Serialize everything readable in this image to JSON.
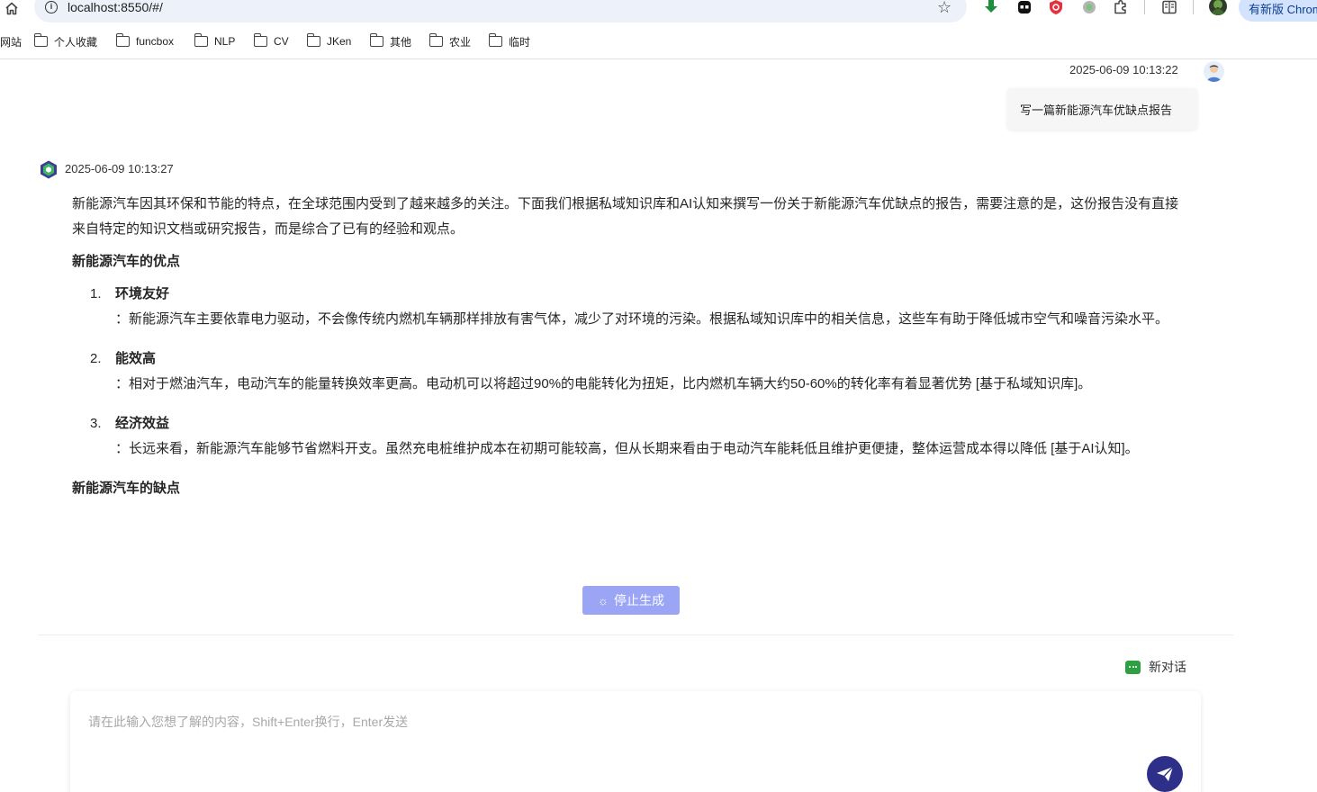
{
  "browser": {
    "url": "localhost:8550/#/",
    "update_label": "有新版 Chrome",
    "bookmarks": [
      {
        "label": "网站",
        "folder": false
      },
      {
        "label": "个人收藏",
        "folder": true
      },
      {
        "label": "funcbox",
        "folder": true
      },
      {
        "label": "NLP",
        "folder": true
      },
      {
        "label": "CV",
        "folder": true
      },
      {
        "label": "JKen",
        "folder": true
      },
      {
        "label": "其他",
        "folder": true
      },
      {
        "label": "农业",
        "folder": true
      },
      {
        "label": "临时",
        "folder": true
      }
    ]
  },
  "chat": {
    "user_message": {
      "time": "2025-06-09 10:13:22",
      "text": "写一篇新能源汽车优缺点报告"
    },
    "bot_message": {
      "time": "2025-06-09 10:13:27",
      "intro": "新能源汽车因其环保和节能的特点，在全球范围内受到了越来越多的关注。下面我们根据私域知识库和AI认知来撰写一份关于新能源汽车优缺点的报告，需要注意的是，这份报告没有直接来自特定的知识文档或研究报告，而是综合了已有的经验和观点。",
      "advantages_title": "新能源汽车的优点",
      "advantages": [
        {
          "num": "1.",
          "title": "环境友好",
          "desc": "：新能源汽车主要依靠电力驱动，不会像传统内燃机车辆那样排放有害气体，减少了对环境的污染。根据私域知识库中的相关信息，这些车有助于降低城市空气和噪音污染水平。"
        },
        {
          "num": "2.",
          "title": "能效高",
          "desc": "：相对于燃油汽车，电动汽车的能量转换效率更高。电动机可以将超过90%的电能转化为扭矩，比内燃机车辆大约50-60%的转化率有着显著优势 [基于私域知识库]。"
        },
        {
          "num": "3.",
          "title": "经济效益",
          "desc": "：长远来看，新能源汽车能够节省燃料开支。虽然充电桩维护成本在初期可能较高，但从长期来看由于电动汽车能耗低且维护更便捷，整体运营成本得以降低 [基于AI认知]。"
        }
      ],
      "disadvantages_title": "新能源汽车的缺点"
    },
    "stop_label": "停止生成",
    "new_chat_label": "新对话",
    "input": {
      "value": "",
      "placeholder": "请在此输入您想了解的内容，Shift+Enter换行，Enter发送"
    }
  },
  "icons": {
    "home": "home-icon",
    "info": "site-info-icon",
    "star": "bookmark-star-icon",
    "download": "download-icon",
    "extension_mask": "ghost-extension-icon",
    "extension_shield": "shield-extension-icon",
    "extension_dot": "circle-extension-icon",
    "extensions": "puzzle-icon",
    "reader": "reading-list-icon",
    "spinner": "loading-spinner-icon",
    "new_chat": "chat-bubble-icon",
    "send": "paper-plane-icon"
  },
  "colors": {
    "stop_button": "#9aa5f5",
    "send_button": "#2e2f88",
    "new_chat_icon": "#2ea043",
    "update_pill": "#d3e3fd"
  }
}
